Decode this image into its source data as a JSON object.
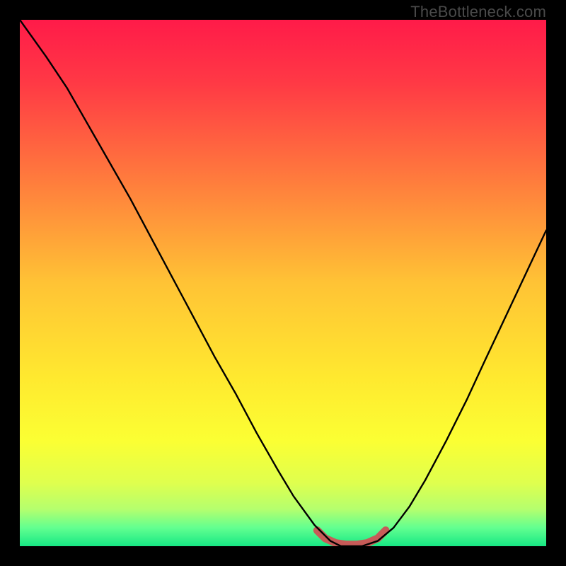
{
  "watermark": "TheBottleneck.com",
  "chart_data": {
    "type": "line",
    "title": "",
    "xlabel": "",
    "ylabel": "",
    "xlim": [
      0,
      1
    ],
    "ylim": [
      0,
      1
    ],
    "background_gradient": {
      "stops": [
        {
          "pos": 0.0,
          "color": "#ff1b49"
        },
        {
          "pos": 0.12,
          "color": "#ff3945"
        },
        {
          "pos": 0.3,
          "color": "#ff7a3d"
        },
        {
          "pos": 0.5,
          "color": "#ffc335"
        },
        {
          "pos": 0.68,
          "color": "#ffe92f"
        },
        {
          "pos": 0.8,
          "color": "#fbff33"
        },
        {
          "pos": 0.88,
          "color": "#dfff4e"
        },
        {
          "pos": 0.93,
          "color": "#b4ff6e"
        },
        {
          "pos": 0.965,
          "color": "#62ff90"
        },
        {
          "pos": 1.0,
          "color": "#17e884"
        }
      ]
    },
    "series": [
      {
        "name": "bottleneck-curve",
        "color": "#000000",
        "x": [
          0.0,
          0.05,
          0.09,
          0.13,
          0.17,
          0.21,
          0.25,
          0.29,
          0.33,
          0.37,
          0.41,
          0.45,
          0.49,
          0.52,
          0.56,
          0.59,
          0.61,
          0.65,
          0.68,
          0.71,
          0.74,
          0.77,
          0.81,
          0.85,
          0.88,
          0.92,
          0.96,
          1.0
        ],
        "y": [
          1.0,
          0.93,
          0.87,
          0.8,
          0.73,
          0.66,
          0.585,
          0.51,
          0.435,
          0.36,
          0.29,
          0.215,
          0.145,
          0.095,
          0.04,
          0.01,
          0.0,
          0.0,
          0.01,
          0.035,
          0.075,
          0.125,
          0.2,
          0.28,
          0.345,
          0.43,
          0.515,
          0.6
        ]
      },
      {
        "name": "optimal-band",
        "color": "#c75b58",
        "x": [
          0.565,
          0.58,
          0.6,
          0.62,
          0.64,
          0.66,
          0.68,
          0.695
        ],
        "y": [
          0.03,
          0.015,
          0.006,
          0.003,
          0.003,
          0.006,
          0.015,
          0.03
        ]
      }
    ]
  }
}
